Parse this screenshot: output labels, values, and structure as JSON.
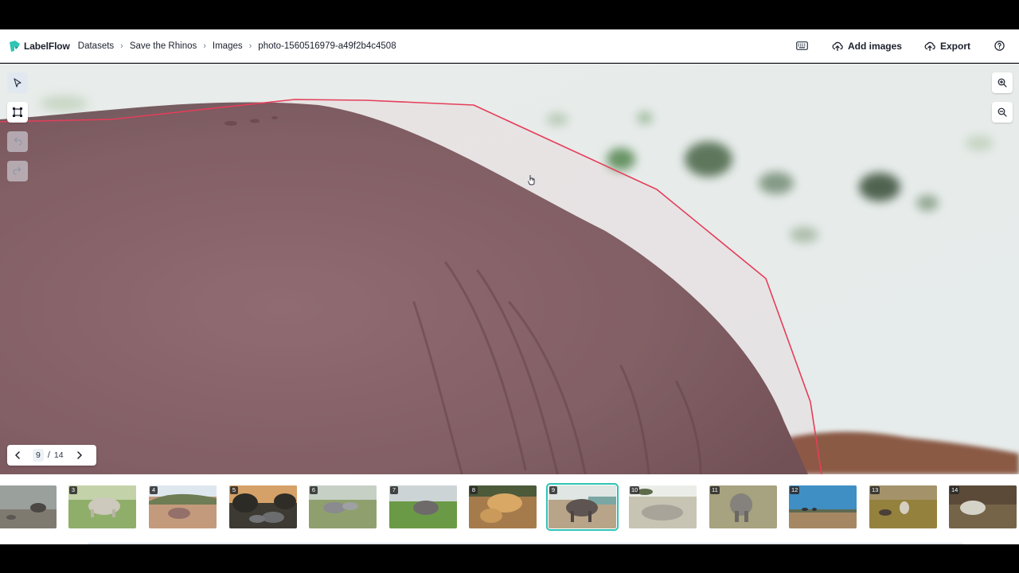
{
  "app": {
    "name": "LabelFlow"
  },
  "breadcrumb": [
    "Datasets",
    "Save the Rhinos",
    "Images",
    "photo-1560516979-a49f2b4c4508"
  ],
  "header_actions": {
    "keyboard_icon": "keyboard-icon",
    "add_images": "Add images",
    "export": "Export",
    "help_icon": "help-icon"
  },
  "tools": [
    {
      "icon": "pointer-icon",
      "state": "active"
    },
    {
      "icon": "bounding-box-icon",
      "state": "enabled"
    },
    {
      "icon": "undo-icon",
      "state": "disabled"
    },
    {
      "icon": "redo-icon",
      "state": "disabled"
    }
  ],
  "zoom": {
    "in_icon": "zoom-in-icon",
    "out_icon": "zoom-out-icon"
  },
  "pager": {
    "current": "9",
    "separator": "/",
    "total": "14"
  },
  "colors": {
    "accent": "#2ec4b6",
    "annotation": "#e53e5a"
  },
  "thumbnails": [
    {
      "num": "",
      "scene": "grey"
    },
    {
      "num": "3",
      "scene": "green-white"
    },
    {
      "num": "4",
      "scene": "dusty-hills"
    },
    {
      "num": "5",
      "scene": "sunset"
    },
    {
      "num": "6",
      "scene": "grass-pair"
    },
    {
      "num": "7",
      "scene": "green-grey"
    },
    {
      "num": "8",
      "scene": "golden-pair"
    },
    {
      "num": "9",
      "scene": "selected-water",
      "selected": true
    },
    {
      "num": "10",
      "scene": "lying"
    },
    {
      "num": "11",
      "scene": "front"
    },
    {
      "num": "12",
      "scene": "blue-sky"
    },
    {
      "num": "13",
      "scene": "dry-field"
    },
    {
      "num": "14",
      "scene": "dark-rock"
    }
  ]
}
